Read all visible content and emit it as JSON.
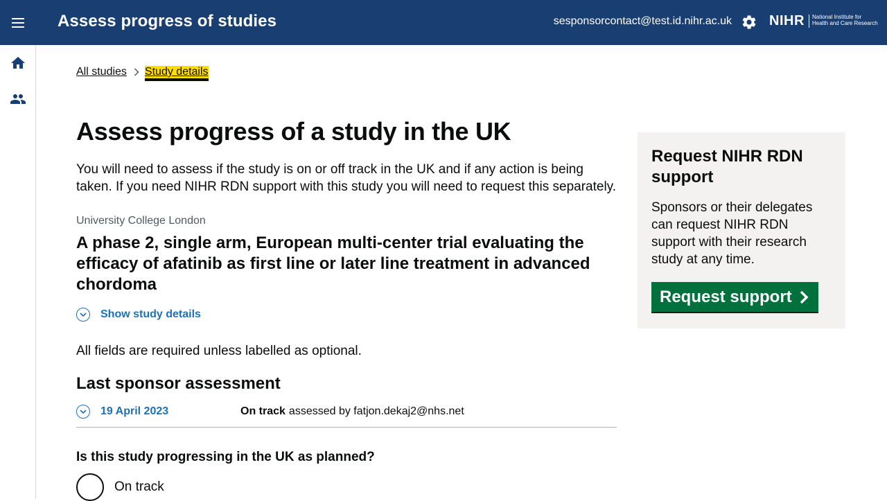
{
  "header": {
    "menu_icon": "hamburger-menu-icon",
    "title": "Assess progress of studies",
    "user_email": "sesponsorcontact@test.id.nihr.ac.uk",
    "settings_icon": "gear-icon",
    "logo": {
      "acronym": "NIHR",
      "line1": "National Institute for",
      "line2": "Health and Care Research"
    }
  },
  "sidebar": {
    "items": [
      {
        "icon": "home-icon"
      },
      {
        "icon": "people-icon"
      }
    ]
  },
  "breadcrumb": {
    "items": [
      "All studies",
      "Study details"
    ]
  },
  "main": {
    "heading": "Assess progress of a study in the UK",
    "intro": "You will need to assess if the study is on or off track in the UK and if any action is being taken. If you need NIHR RDN support with this study you will need to request this separately.",
    "organisation": "University College London",
    "study_title": "A phase 2, single arm, European multi-center trial evaluating the efficacy of afatinib as first line or later line treatment in advanced chordoma",
    "show_details_label": "Show study details",
    "fields_note": "All fields are required unless labelled as optional.",
    "last_assessment": {
      "heading": "Last sponsor assessment",
      "date": "19 April 2023",
      "status": "On track",
      "assessed_by": "assessed by fatjon.dekaj2@nhs.net"
    },
    "question": "Is this study progressing in the UK as planned?",
    "options": [
      "On track"
    ]
  },
  "panel": {
    "title": "Request NIHR RDN support",
    "text": "Sponsors or their delegates can request NIHR RDN support with their research study at any time.",
    "button_label": "Request support"
  },
  "colors": {
    "header_bg": "#193e72",
    "link": "#1d70b8",
    "button_green": "#00703c",
    "breadcrumb_highlight": "#ffdd00",
    "panel_bg": "#f3f2f1"
  }
}
